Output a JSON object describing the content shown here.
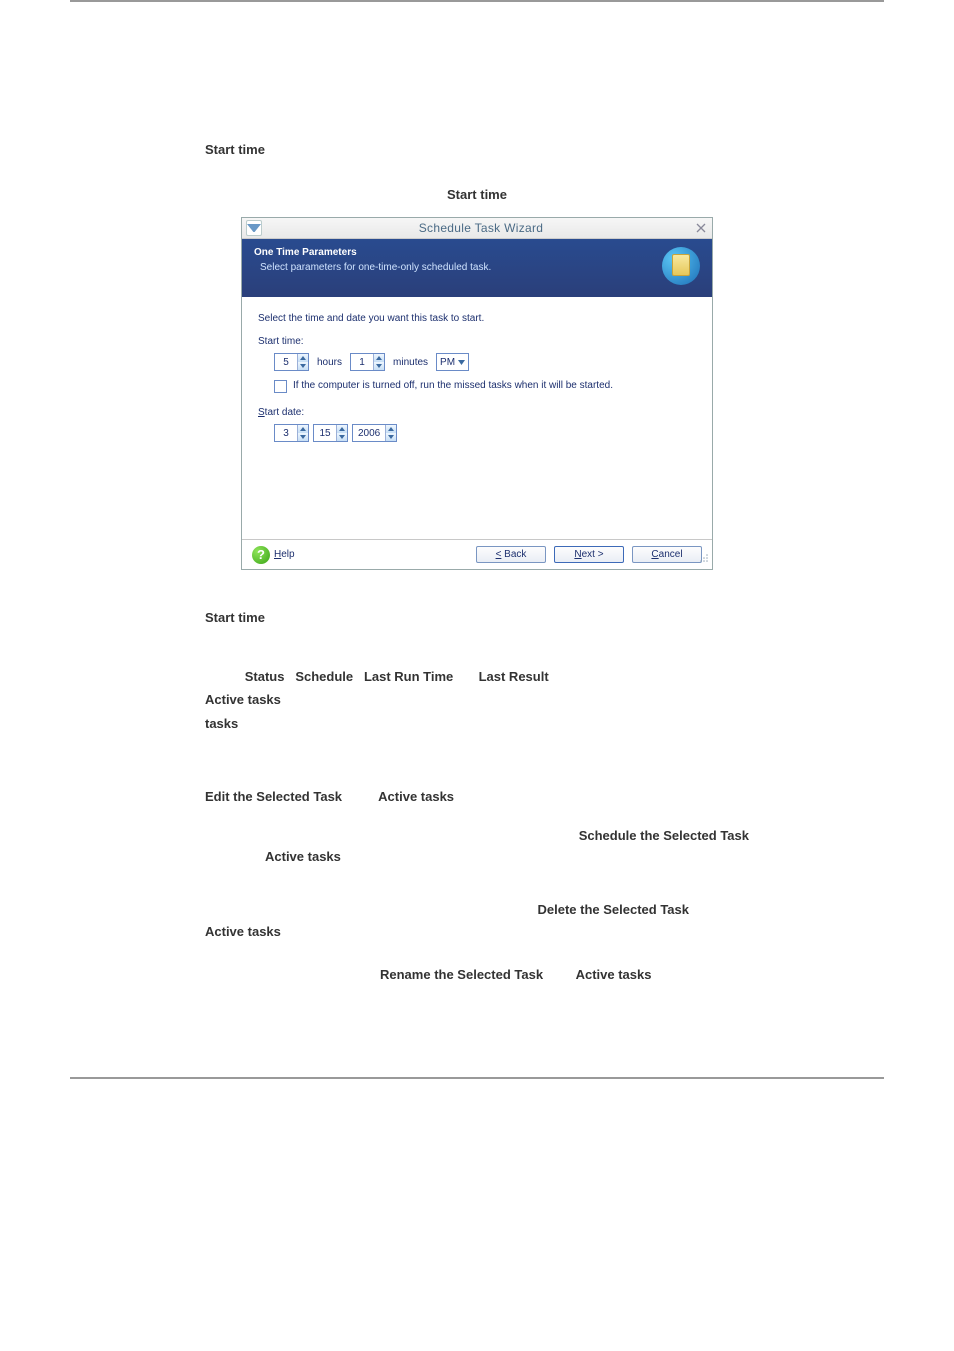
{
  "section_heading_1": "Start time",
  "caption": "Start time",
  "dialog": {
    "title": "Schedule Task Wizard",
    "header_title": "One Time Parameters",
    "header_sub": "Select parameters for one-time-only scheduled task.",
    "body_intro": "Select the time and date you want this task to start.",
    "start_time_label": "Start time:",
    "hours_value": "5",
    "hours_unit": "hours",
    "minutes_value": "1",
    "minutes_unit": "minutes",
    "ampm": "PM",
    "checkbox_label": "If the computer is turned off, run the missed tasks when it will be started.",
    "start_date_label": "Start date:",
    "date_month": "3",
    "date_day": "15",
    "date_year": "2006",
    "help_label": "Help",
    "back_label": "< Back",
    "next_label": "Next >",
    "cancel_label": "Cancel"
  },
  "section_heading_2": "Start time",
  "headers": {
    "status": "Status",
    "schedule": "Schedule",
    "lastrun": "Last Run Time",
    "lastres": "Last Result",
    "active": "Active tasks"
  },
  "items": {
    "edit": "Edit the Selected Task",
    "active1": "Active tasks",
    "schedule_sel": "Schedule the Selected Task",
    "active2": "Active tasks",
    "delete_sel": "Delete the Selected Task",
    "active3": "Active tasks",
    "rename_sel": "Rename the Selected Task",
    "active4": "Active tasks"
  }
}
